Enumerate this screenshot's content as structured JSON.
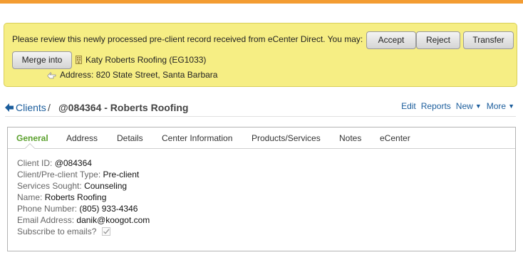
{
  "notice": {
    "message": "Please review this newly processed pre-client record received from eCenter Direct. You may:",
    "accept_label": "Accept",
    "reject_label": "Reject",
    "transfer_label": "Transfer",
    "merge_label": "Merge into",
    "record_name": "Katy Roberts Roofing (EG1033)",
    "address": "Address: 820 State Street, Santa Barbara"
  },
  "header": {
    "breadcrumb_clients": "Clients",
    "separator": "/",
    "record_title": "@084364 - Roberts Roofing",
    "actions": {
      "edit": "Edit",
      "reports": "Reports",
      "new": "New",
      "more": "More"
    }
  },
  "tabs": [
    {
      "label": "General",
      "active": true
    },
    {
      "label": "Address"
    },
    {
      "label": "Details"
    },
    {
      "label": "Center Information"
    },
    {
      "label": "Products/Services"
    },
    {
      "label": "Notes"
    },
    {
      "label": "eCenter"
    }
  ],
  "fields": [
    {
      "label": "Client ID:",
      "value": "@084364"
    },
    {
      "label": "Client/Pre-client Type:",
      "value": "Pre-client"
    },
    {
      "label": "Services Sought:",
      "value": "Counseling"
    },
    {
      "label": "Name:",
      "value": "Roberts Roofing"
    },
    {
      "label": "Phone Number:",
      "value": "(805) 933-4346"
    },
    {
      "label": "Email Address:",
      "value": "danik@koogot.com"
    },
    {
      "label": "Subscribe to emails?",
      "value": ""
    }
  ],
  "subscribe_checked": true,
  "icons": {
    "back": "arrow-left-icon",
    "building": "building-icon",
    "pointer": "pointing-hand-icon",
    "checkbox": "checkbox-checked-icon"
  },
  "colors": {
    "top_bar": "#f39c32",
    "notice_bg": "#f6ee84",
    "link": "#1b5d9c",
    "active_tab": "#5aa02c"
  }
}
